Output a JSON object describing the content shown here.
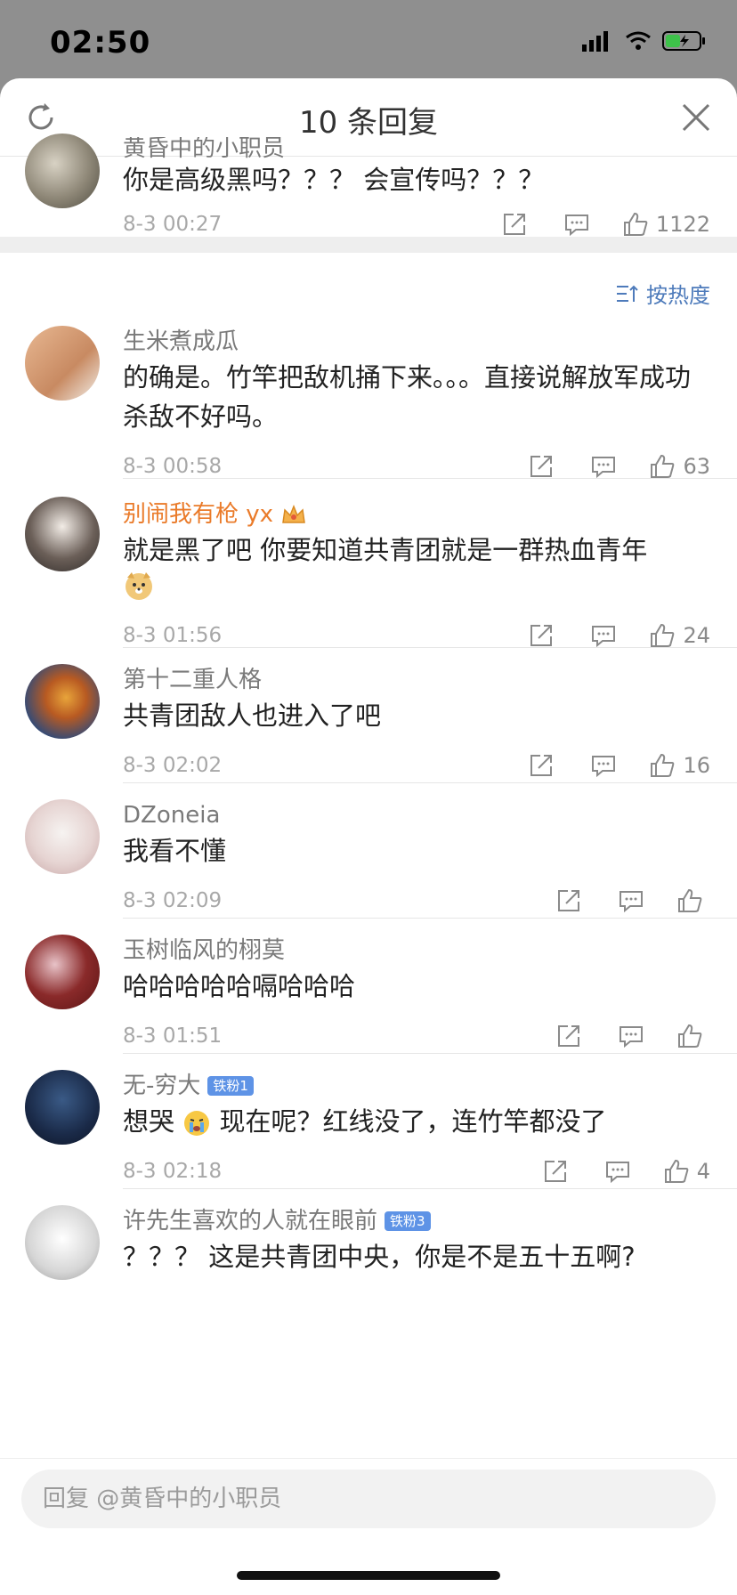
{
  "status": {
    "time": "02:50"
  },
  "header": {
    "title": "10 条回复"
  },
  "sort": {
    "label": "按热度"
  },
  "pinned": {
    "username": "黄昏中的小职员",
    "text": "你是高级黑吗？？？ 会宣传吗？？？",
    "date": "8-3 00:27",
    "likes": "1122"
  },
  "comments": [
    {
      "username": "生米煮成瓜",
      "text": "的确是。竹竿把敌机捅下来。。。直接说解放军成功杀敌不好吗。",
      "date": "8-3 00:58",
      "likes": "63"
    },
    {
      "username": "别闹我有枪 yx",
      "text": "就是黑了吧  你要知道共青团就是一群热血青年",
      "date": "8-3 01:56",
      "likes": "24"
    },
    {
      "username": "第十二重人格",
      "text": "共青团敌人也进入了吧",
      "date": "8-3 02:02",
      "likes": "16"
    },
    {
      "username": "DZoneia",
      "text": "我看不懂",
      "date": "8-3 02:09",
      "likes": ""
    },
    {
      "username": "玉树临风的栩莫",
      "text": "哈哈哈哈哈嗝哈哈哈",
      "date": "8-3 01:51",
      "likes": ""
    },
    {
      "username": "无-穷大",
      "badge": "铁粉1",
      "text_a": "想哭",
      "text_b": "现在呢？红线没了，连竹竿都没了",
      "date": "8-3 02:18",
      "likes": "4"
    },
    {
      "username": "许先生喜欢的人就在眼前",
      "badge": "铁粉3",
      "text": "？？？ 这是共青团中央，你是不是五十五啊?"
    }
  ],
  "reply": {
    "placeholder": "回复 @黄昏中的小职员"
  },
  "colors": {
    "accent_blue": "#4e7bbb",
    "vip_orange": "#ea7b2a",
    "badge_blue": "#5e93e6"
  }
}
